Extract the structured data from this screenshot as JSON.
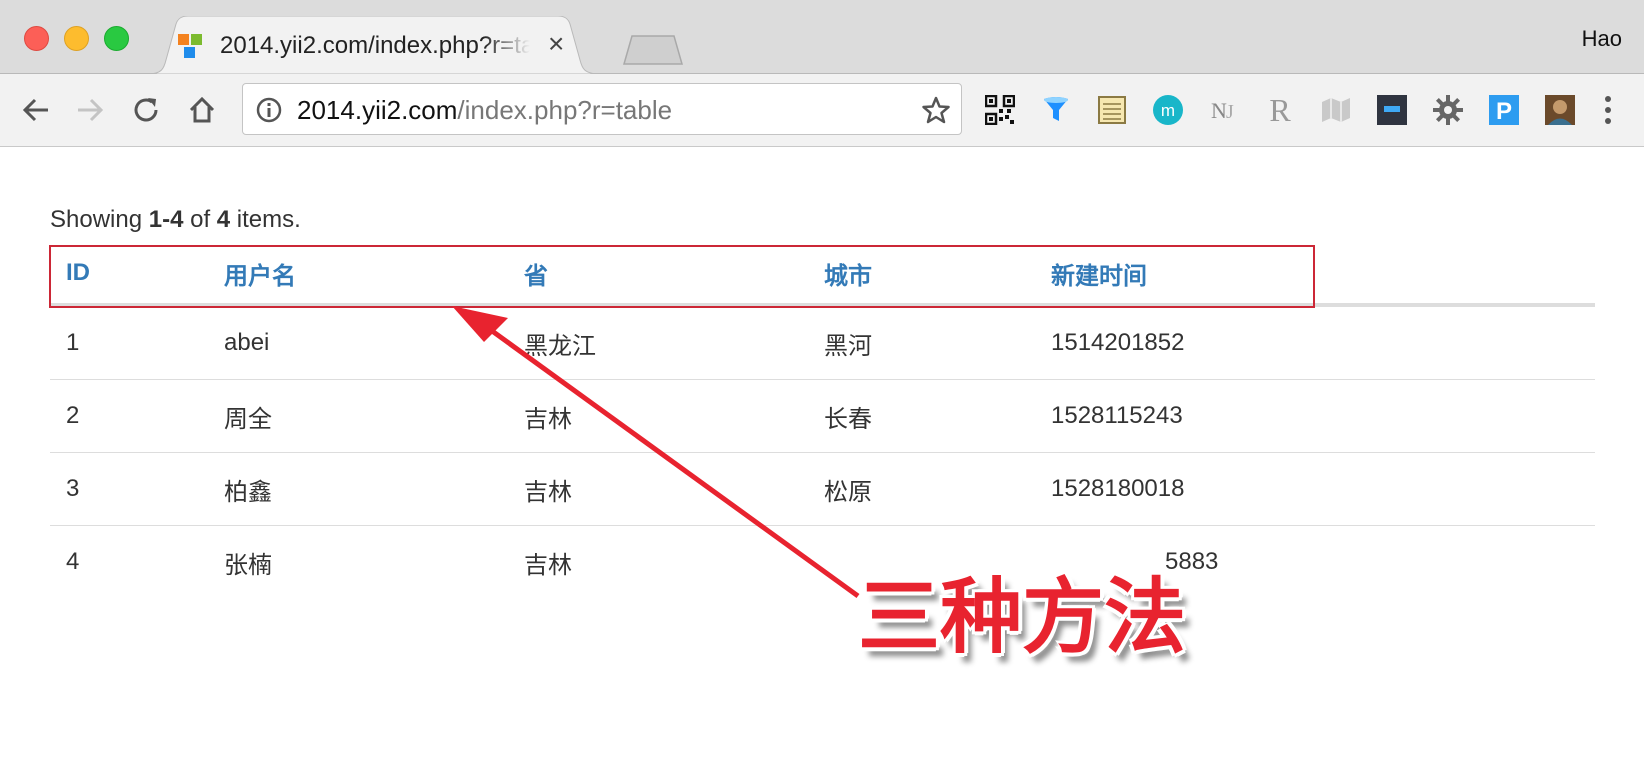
{
  "browser": {
    "tab_title": "2014.yii2.com/index.php?r=table",
    "profile_name": "Hao",
    "url_host": "2014.yii2.com",
    "url_path": "/index.php?r=table"
  },
  "page": {
    "summary": {
      "prefix": "Showing ",
      "range": "1-4",
      "middle": " of ",
      "total": "4",
      "suffix": " items."
    },
    "table": {
      "headers": [
        "ID",
        "用户名",
        "省",
        "城市",
        "新建时间"
      ],
      "rows": [
        [
          "1",
          "abei",
          "黑龙江",
          "黑河",
          "1514201852"
        ],
        [
          "2",
          "周全",
          "吉林",
          "长春",
          "1528115243"
        ],
        [
          "3",
          "柏鑫",
          "吉林",
          "松原",
          "1528180018"
        ],
        [
          "4",
          "张楠",
          "吉林",
          "",
          "5883"
        ]
      ]
    }
  },
  "annotation": {
    "callout_text": "三种方法",
    "color": "#e8232f"
  },
  "colors": {
    "header_link": "#337ab7",
    "text": "#333333"
  }
}
